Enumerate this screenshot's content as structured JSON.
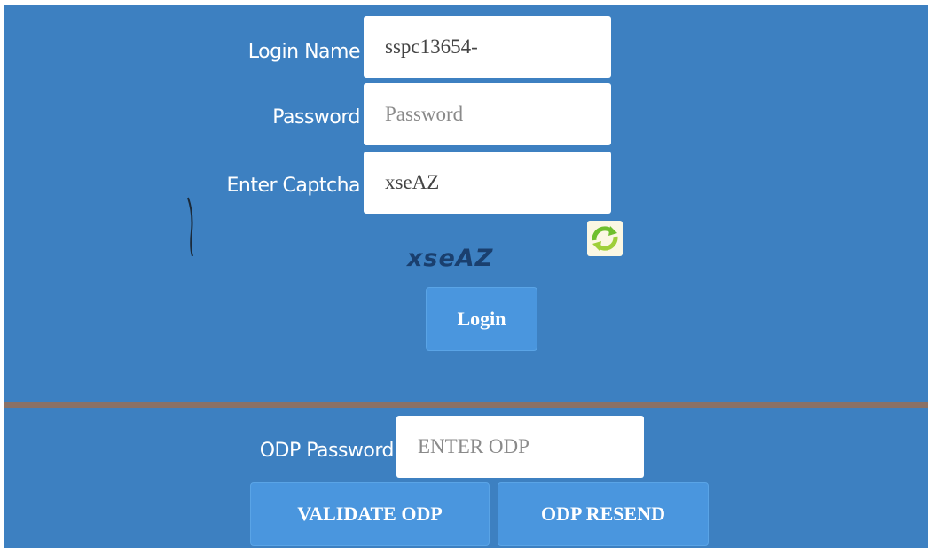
{
  "login": {
    "name_label": "Login Name",
    "name_value": "sspc13654-",
    "password_label": "Password",
    "password_placeholder": "Password",
    "captcha_label": "Enter Captcha",
    "captcha_value": "xseAZ",
    "captcha_image_text": "xseAZ",
    "refresh_icon": "refresh-icon",
    "login_button": "Login"
  },
  "odp": {
    "password_label": "ODP Password",
    "password_placeholder": "ENTER ODP",
    "validate_button": "VALIDATE ODP",
    "resend_button": "ODP RESEND"
  },
  "colors": {
    "background": "#3d80c1",
    "button": "#4a96de",
    "divider": "#8b7166"
  }
}
